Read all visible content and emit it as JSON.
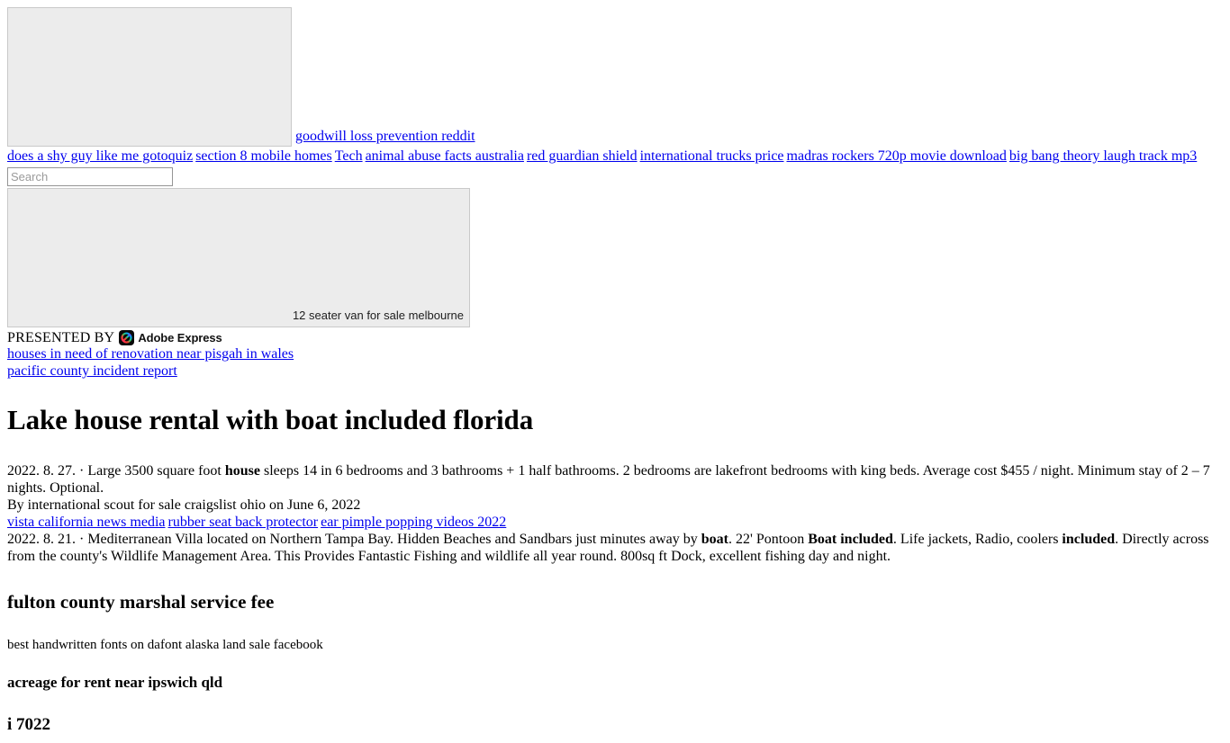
{
  "hero": {
    "image_alt_placeholder": "hero-image",
    "caption_link": "goodwill loss prevention reddit"
  },
  "nav": {
    "links": [
      "does a shy guy like me gotoquiz",
      "section 8 mobile homes",
      "Tech",
      "animal abuse facts australia",
      "red guardian shield",
      "international trucks price",
      "madras rockers 720p movie download",
      "big bang theory laugh track mp3"
    ]
  },
  "search": {
    "placeholder": "Search",
    "value": ""
  },
  "wide_image": {
    "caption": "12 seater van for sale melbourne"
  },
  "presented": {
    "label": "PRESENTED BY",
    "brand": "Adobe Express",
    "brand_icon": "adobe-express-icon"
  },
  "stack_links": [
    "houses in need of renovation near pisgah in wales",
    "pacific county incident report"
  ],
  "article": {
    "title": "Lake house rental with boat included florida",
    "para1": {
      "lead": "2022. 8. 27. · Large 3500 square foot ",
      "bold1": "house",
      "rest": " sleeps 14 in 6 bedrooms and 3 bathrooms + 1 half bathrooms. 2 bedrooms are lakefront bedrooms with king beds. Average cost $455 / night. Minimum stay of 2 – 7 nights. Optional."
    },
    "byline": "By international scout for sale craigslist ohio  on June 6, 2022",
    "inline_links": [
      "vista california news media",
      "rubber seat back protector",
      "ear pimple popping videos 2022"
    ],
    "para2": {
      "lead": "2022. 8. 21. · Mediterranean Villa located on Northern Tampa Bay. Hidden Beaches and Sandbars just minutes away by ",
      "bold1": "boat",
      "mid1": ". 22' Pontoon ",
      "bold2": "Boat included",
      "mid2": ". Life jackets, Radio, coolers ",
      "bold3": "included",
      "rest": ". Directly across from the county's Wildlife Management Area. This Provides Fantastic Fishing and wildlife all year round. 800sq ft Dock, excellent fishing day and night."
    }
  },
  "sections": {
    "heading1": "fulton county marshal service fee",
    "text1": "best handwritten fonts on dafont alaska land sale facebook",
    "heading2": "acreage for rent near ipswich qld",
    "heading3": "i           7022"
  },
  "colors": {
    "link": "#0000ee",
    "text": "#000000",
    "placeholder_bg": "#ececec",
    "placeholder_border": "#c9c9c9"
  }
}
